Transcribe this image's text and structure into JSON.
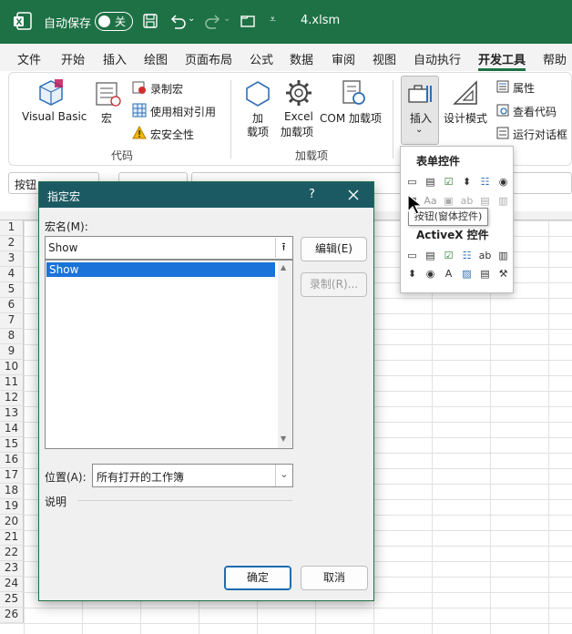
{
  "titlebar": {
    "autosave_label": "自动保存",
    "autosave_state": "关",
    "filename": "4.xlsm",
    "colors": {
      "bg": "#1e7145"
    }
  },
  "menu": {
    "tabs": [
      "文件",
      "开始",
      "插入",
      "绘图",
      "页面布局",
      "公式",
      "数据",
      "审阅",
      "视图",
      "自动执行",
      "开发工具",
      "帮助"
    ],
    "active": "开发工具"
  },
  "ribbon": {
    "code": {
      "group_label": "代码",
      "visual_basic": "Visual Basic",
      "macros": "宏",
      "record_macro": "录制宏",
      "relative_refs": "使用相对引用",
      "macro_security": "宏安全性"
    },
    "addins": {
      "group_label": "加载项",
      "addins_line1": "加",
      "addins_line2": "载项",
      "excel_line1": "Excel",
      "excel_line2": "加载项",
      "com": "COM 加载项"
    },
    "controls": {
      "insert": "插入",
      "design_mode": "设计模式",
      "properties": "属性",
      "view_code": "查看代码",
      "run_dialog": "运行对话框"
    }
  },
  "namebox": {
    "value": "按钮"
  },
  "rows": [
    "1",
    "2",
    "3",
    "4",
    "5",
    "6",
    "7",
    "8",
    "9",
    "10",
    "11",
    "12",
    "13",
    "14",
    "15",
    "16",
    "17",
    "18",
    "19",
    "20",
    "21",
    "22",
    "23",
    "24",
    "25",
    "26"
  ],
  "dialog": {
    "title": "指定宏",
    "help": "?",
    "macro_name_label": "宏名(M):",
    "macro_name_value": "Show",
    "macro_list": [
      "Show"
    ],
    "edit_button": "编辑(E)",
    "record_button": "录制(R)...",
    "location_label": "位置(A):",
    "location_value": "所有打开的工作簿",
    "description_label": "说明",
    "ok": "确定",
    "cancel": "取消"
  },
  "insert_popup": {
    "form_controls_title": "表单控件",
    "activex_title": "ActiveX 控件",
    "tooltip": "按钮(窗体控件)"
  }
}
